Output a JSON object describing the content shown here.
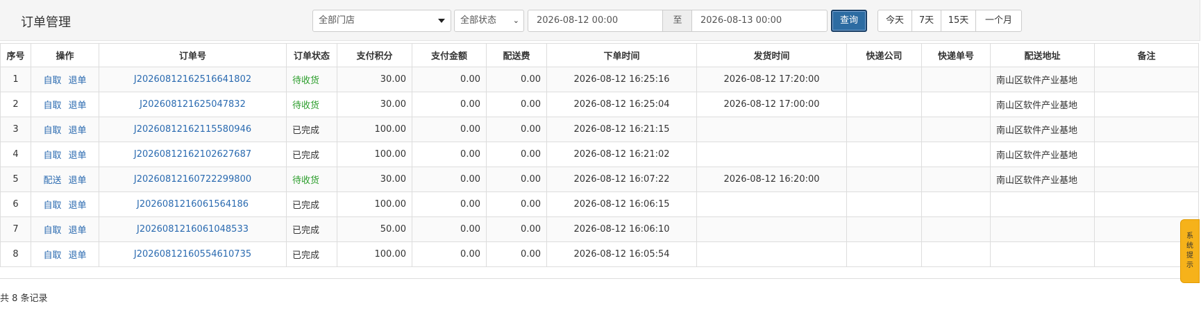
{
  "page": {
    "title": "订单管理"
  },
  "filters": {
    "store_select": "全部门店",
    "status_select": "全部状态",
    "start_date": "2026-08-12 00:00",
    "separator": "至",
    "end_date": "2026-08-13 00:00",
    "query_button": "查询",
    "quick_ranges": [
      "今天",
      "7天",
      "15天",
      "一个月"
    ]
  },
  "table": {
    "headers": [
      "序号",
      "操作",
      "订单号",
      "订单状态",
      "支付积分",
      "支付金额",
      "配送费",
      "下单时间",
      "发货时间",
      "快递公司",
      "快递单号",
      "配送地址",
      "备注"
    ],
    "rows": [
      {
        "no": "1",
        "op1": "自取",
        "op2": "退单",
        "order": "J20260812162516641802",
        "status": "待收货",
        "points": "30.00",
        "amount": "0.00",
        "fee": "0.00",
        "created": "2026-08-12 16:25:16",
        "shipped": "2026-08-12 17:20:00",
        "company": "",
        "tracking": "",
        "address": "南山区软件产业基地",
        "remark": ""
      },
      {
        "no": "2",
        "op1": "自取",
        "op2": "退单",
        "order": "J202608121625047832",
        "status": "待收货",
        "points": "30.00",
        "amount": "0.00",
        "fee": "0.00",
        "created": "2026-08-12 16:25:04",
        "shipped": "2026-08-12 17:00:00",
        "company": "",
        "tracking": "",
        "address": "南山区软件产业基地",
        "remark": ""
      },
      {
        "no": "3",
        "op1": "自取",
        "op2": "退单",
        "order": "J20260812162115580946",
        "status": "已完成",
        "points": "100.00",
        "amount": "0.00",
        "fee": "0.00",
        "created": "2026-08-12 16:21:15",
        "shipped": "",
        "company": "",
        "tracking": "",
        "address": "南山区软件产业基地",
        "remark": ""
      },
      {
        "no": "4",
        "op1": "自取",
        "op2": "退单",
        "order": "J20260812162102627687",
        "status": "已完成",
        "points": "100.00",
        "amount": "0.00",
        "fee": "0.00",
        "created": "2026-08-12 16:21:02",
        "shipped": "",
        "company": "",
        "tracking": "",
        "address": "南山区软件产业基地",
        "remark": ""
      },
      {
        "no": "5",
        "op1": "配送",
        "op2": "退单",
        "order": "J20260812160722299800",
        "status": "待收货",
        "points": "30.00",
        "amount": "0.00",
        "fee": "0.00",
        "created": "2026-08-12 16:07:22",
        "shipped": "2026-08-12 16:20:00",
        "company": "",
        "tracking": "",
        "address": "南山区软件产业基地",
        "remark": ""
      },
      {
        "no": "6",
        "op1": "自取",
        "op2": "退单",
        "order": "J2026081216061564186",
        "status": "已完成",
        "points": "100.00",
        "amount": "0.00",
        "fee": "0.00",
        "created": "2026-08-12 16:06:15",
        "shipped": "",
        "company": "",
        "tracking": "",
        "address": "",
        "remark": ""
      },
      {
        "no": "7",
        "op1": "自取",
        "op2": "退单",
        "order": "J2026081216061048533",
        "status": "已完成",
        "points": "50.00",
        "amount": "0.00",
        "fee": "0.00",
        "created": "2026-08-12 16:06:10",
        "shipped": "",
        "company": "",
        "tracking": "",
        "address": "",
        "remark": ""
      },
      {
        "no": "8",
        "op1": "自取",
        "op2": "退单",
        "order": "J20260812160554610735",
        "status": "已完成",
        "points": "100.00",
        "amount": "0.00",
        "fee": "0.00",
        "created": "2026-08-12 16:05:54",
        "shipped": "",
        "company": "",
        "tracking": "",
        "address": "",
        "remark": ""
      }
    ]
  },
  "footer": {
    "total_text": "共 8 条记录"
  },
  "sys_tip": {
    "label": "系统提示",
    "chars": [
      "系",
      "统",
      "提",
      "示"
    ]
  },
  "colors": {
    "primary": "#2d6ca2",
    "link": "#2a6ab0",
    "status_pending": "#2a9d2a",
    "tip_bg": "#f6b21a"
  },
  "icons": {
    "select_caret": "caret-down-icon",
    "status_chevron": "chevron-down-icon"
  }
}
